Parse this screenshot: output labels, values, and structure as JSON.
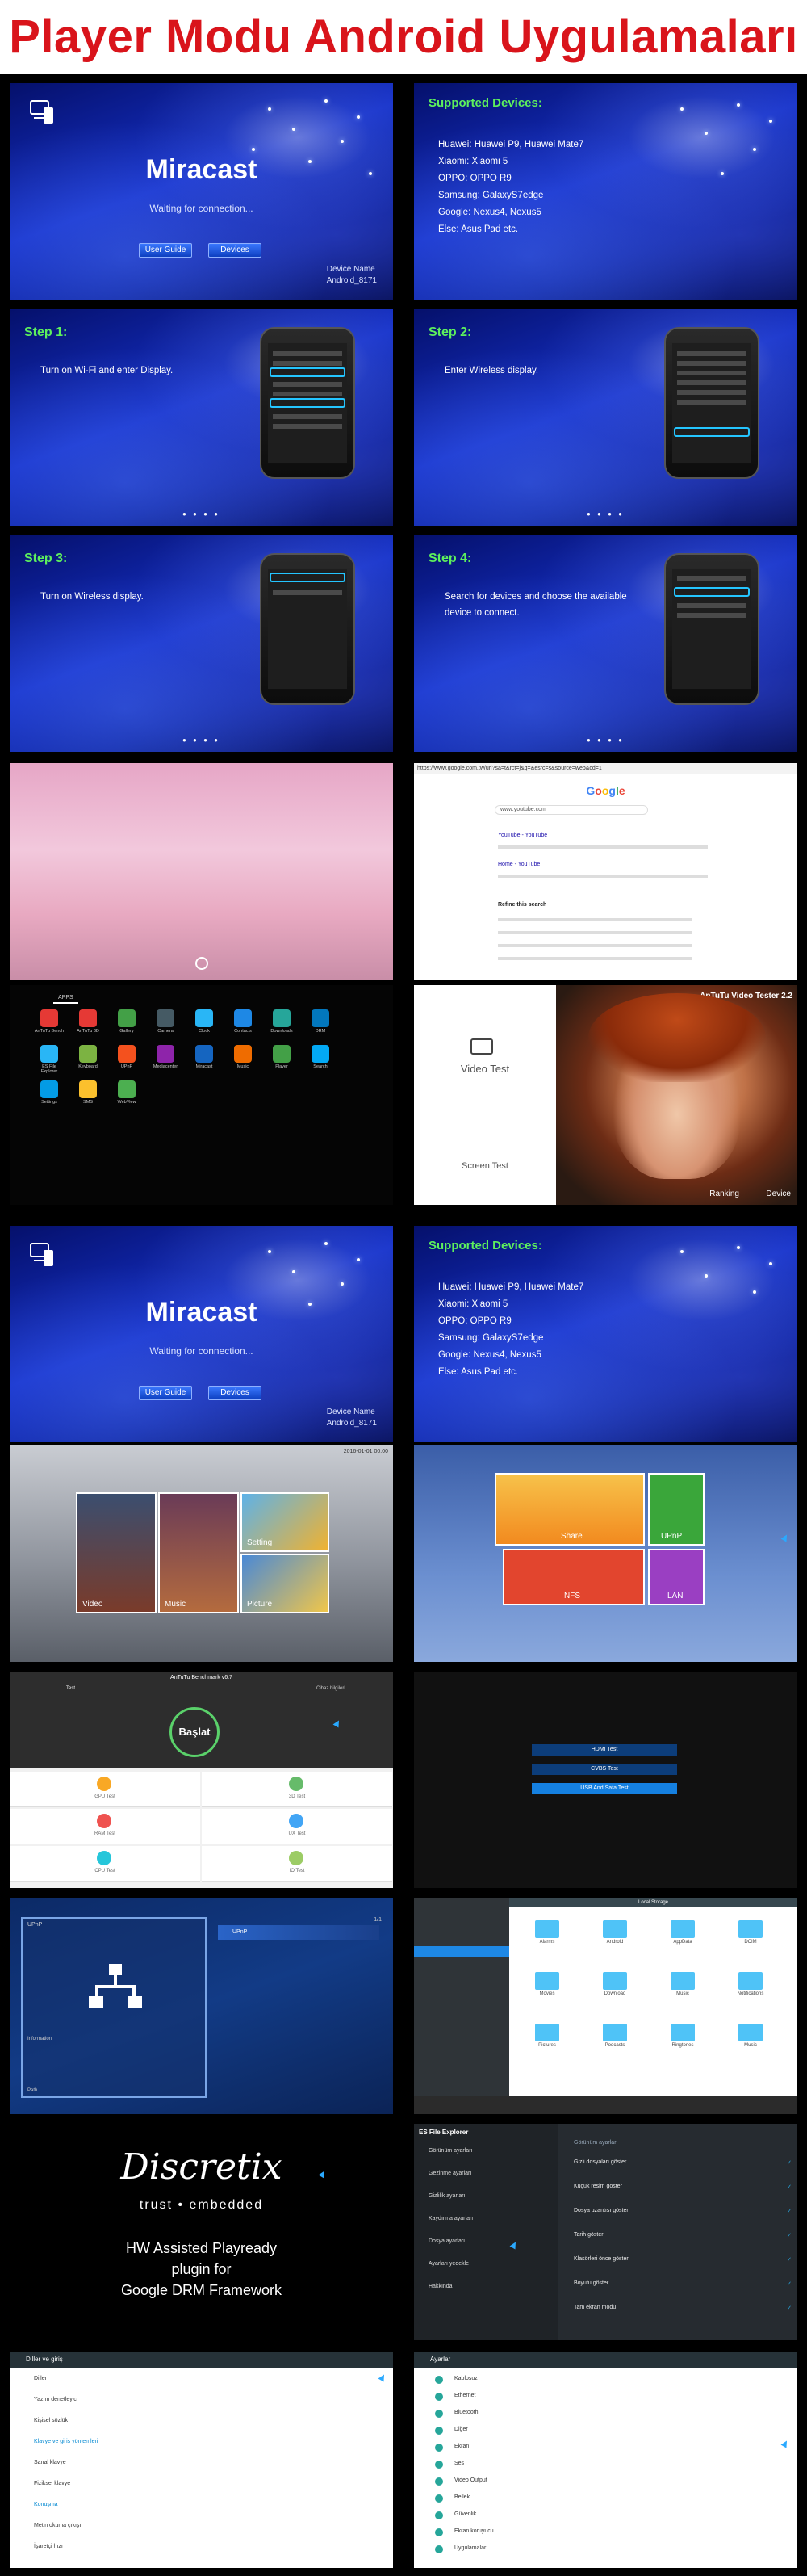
{
  "title": "Player Modu Android Uygulamaları",
  "miracast": {
    "title": "Miracast",
    "status": "Waiting for connection...",
    "btn_guide": "User Guide",
    "btn_devices": "Devices",
    "device_name_label": "Device Name",
    "device_name_value": "Android_8171"
  },
  "supported": {
    "title": "Supported Devices:",
    "items": [
      "Huawei: Huawei P9, Huawei Mate7",
      "Xiaomi: Xiaomi 5",
      "OPPO: OPPO R9",
      "Samsung: GalaxyS7edge",
      "Google: Nexus4, Nexus5",
      "Else: Asus Pad etc."
    ]
  },
  "steps": [
    {
      "title": "Step 1:",
      "text": "Turn on Wi-Fi and enter Display."
    },
    {
      "title": "Step 2:",
      "text": "Enter Wireless display."
    },
    {
      "title": "Step 3:",
      "text": "Turn on Wireless display."
    },
    {
      "title": "Step 4:",
      "text": "Search for devices and choose the available device to connect."
    }
  ],
  "browser": {
    "url": "https://www.google.com.tw/url?sa=t&rct=j&q=&esrc=s&source=web&cd=1",
    "logo": "Google",
    "query": "www.youtube.com",
    "results": [
      "YouTube - YouTube",
      "Home - YouTube",
      "Refine this search"
    ]
  },
  "apps": {
    "tab": "APPS",
    "items": [
      "AnTuTu Bench",
      "AnTuTu 3D",
      "Gallery",
      "Camera",
      "Clock",
      "Contacts",
      "Downloads",
      "DRM",
      "ES File Explorer",
      "Keyboard",
      "UPnP",
      "Mediacenter",
      "Miracast",
      "Music",
      "Player",
      "Search",
      "Settings",
      "SMS",
      "WebView"
    ]
  },
  "video_tester": {
    "title": "AnTuTu Video Tester 2.2",
    "video_test": "Video Test",
    "screen_test": "Screen Test",
    "ranking": "Ranking",
    "device": "Device"
  },
  "media_hub": {
    "time": "2016-01-01 00:00",
    "video": "Video",
    "music": "Music",
    "setting": "Setting",
    "picture": "Picture"
  },
  "share": {
    "share": "Share",
    "upnp": "UPnP",
    "nfs": "NFS",
    "lan": "LAN"
  },
  "antutu": {
    "title": "AnTuTu Benchmark v6.7",
    "tab1": "Test",
    "tab2": "Cihaz bilgileri",
    "start": "Başlat",
    "items": [
      "GPU Test",
      "3D Test",
      "RAM Test",
      "UX Test",
      "CPU Test",
      "IO Test"
    ]
  },
  "drm_test": {
    "btn1": "HDMI Test",
    "btn2": "CVBS Test",
    "btn3": "USB And Sata Test"
  },
  "upnp": {
    "title": "UPnP",
    "item": "UPnP",
    "info": "Information",
    "path": "Path",
    "page": "1/1"
  },
  "file_manager": {
    "title": "Local Storage",
    "folders": [
      "Alarms",
      "Android",
      "AppData",
      "DCIM",
      "Movies",
      "Download",
      "Music",
      "Notifications",
      "Pictures",
      "Podcasts",
      "Ringtones",
      "Music"
    ]
  },
  "discretix": {
    "brand": "Discretix",
    "tagline": "trust • embedded",
    "line1": "HW Assisted Playready",
    "line2": "plugin for",
    "line3": "Google DRM Framework"
  },
  "es_explorer": {
    "title": "ES File Explorer",
    "section": "Görünüm ayarları",
    "menu": [
      "Görünüm ayarları",
      "Gezinme ayarları",
      "Gizlilik ayarları",
      "Kaydırma ayarları",
      "Dosya ayarları",
      "Ayarları yedekle",
      "Hakkında"
    ],
    "options": [
      "Gizli dosyaları göster",
      "Küçük resim göster",
      "Dosya uzantısı göster",
      "Tarih göster",
      "Klasörleri önce göster",
      "Boyutu göster",
      "Tam ekran modu"
    ]
  },
  "settings_left": {
    "title": "Diller ve giriş",
    "items": [
      "Diller",
      "Yazım denetleyici",
      "Kişisel sözlük",
      "Klavye ve giriş yöntemleri",
      "Sanal klavye",
      "Fiziksel klavye",
      "Konuşma",
      "Metin okuma çıkışı",
      "İşaretçi hızı"
    ]
  },
  "settings_right": {
    "title": "Ayarlar",
    "items": [
      "Kablosuz",
      "Ethernet",
      "Bluetooth",
      "Diğer",
      "Ekran",
      "Ses",
      "Video Output",
      "Bellek",
      "Güvenlik",
      "Ekran koruyucu",
      "Uygulamalar"
    ]
  }
}
